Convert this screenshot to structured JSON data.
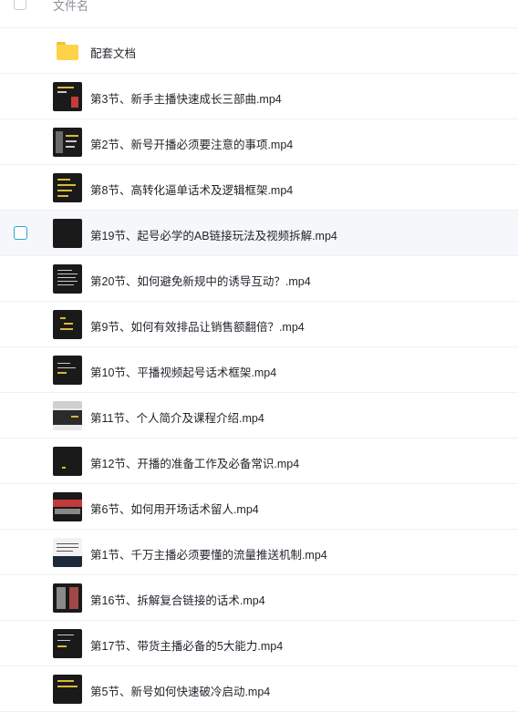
{
  "header": {
    "column_label": "文件名"
  },
  "files": [
    {
      "name": "配套文档",
      "type": "folder"
    },
    {
      "name": "第3节、新手主播快速成长三部曲.mp4",
      "type": "video"
    },
    {
      "name": "第2节、新号开播必须要注意的事项.mp4",
      "type": "video"
    },
    {
      "name": "第8节、高转化逼单话术及逻辑框架.mp4",
      "type": "video"
    },
    {
      "name": "第19节、起号必学的AB链接玩法及视频拆解.mp4",
      "type": "video",
      "hovered": true
    },
    {
      "name": "第20节、如何避免新规中的诱导互动？.mp4",
      "type": "video"
    },
    {
      "name": "第9节、如何有效排品让销售额翻倍？.mp4",
      "type": "video"
    },
    {
      "name": "第10节、平播视频起号话术框架.mp4",
      "type": "video"
    },
    {
      "name": "第11节、个人简介及课程介绍.mp4",
      "type": "video"
    },
    {
      "name": "第12节、开播的准备工作及必备常识.mp4",
      "type": "video"
    },
    {
      "name": "第6节、如何用开场话术留人.mp4",
      "type": "video"
    },
    {
      "name": "第1节、千万主播必须要懂的流量推送机制.mp4",
      "type": "video"
    },
    {
      "name": "第16节、拆解复合链接的话术.mp4",
      "type": "video"
    },
    {
      "name": "第17节、带货主播必备的5大能力.mp4",
      "type": "video"
    },
    {
      "name": "第5节、新号如何快速破冷启动.mp4",
      "type": "video"
    }
  ],
  "colors": {
    "accent": "#2aa7c9",
    "folder": "#fdd34a",
    "row_hover": "#f5f7fa",
    "divider": "#eef0f3"
  }
}
